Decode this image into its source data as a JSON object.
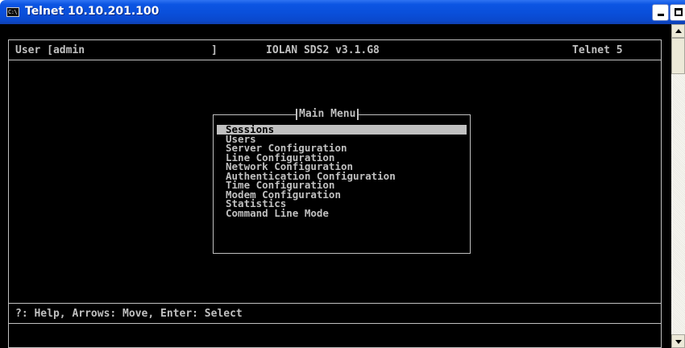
{
  "window": {
    "title": "Telnet 10.10.201.100",
    "icon_name": "console-window-icon",
    "icon_glyph": "C:\\",
    "controls": [
      "minimize",
      "maximize"
    ]
  },
  "terminal": {
    "header": {
      "user": "User [admin",
      "user_bracket_close": "]",
      "product": "IOLAN SDS2 v3.1.G8",
      "session": "Telnet 5"
    },
    "menu": {
      "title": "Main Menu",
      "selected_index": 0,
      "items": [
        "Sessions",
        "Users",
        "Server Configuration",
        "Line Configuration",
        "Network Configuration",
        "Authentication Configuration",
        "Time Configuration",
        "Modem Configuration",
        "Statistics",
        "Command Line Mode"
      ]
    },
    "footer": {
      "help": "?: Help, Arrows: Move, Enter: Select"
    }
  },
  "colors": {
    "titlebar": "#0a4fda",
    "console_bg": "#000000",
    "console_fg": "#c0c0c0",
    "highlight_bg": "#c0c0c0",
    "highlight_fg": "#000000"
  }
}
